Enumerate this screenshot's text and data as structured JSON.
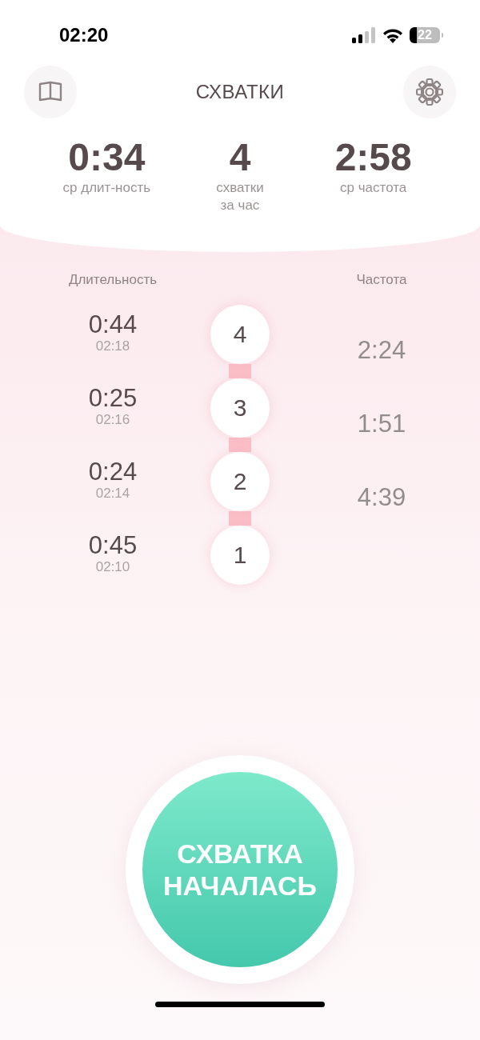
{
  "status_bar": {
    "time": "02:20",
    "battery": "22"
  },
  "header": {
    "title": "СХВАТКИ"
  },
  "stats": [
    {
      "value": "0:34",
      "label": "ср длит-ность"
    },
    {
      "value": "4",
      "label": "схватки\nза час"
    },
    {
      "value": "2:58",
      "label": "ср частота"
    }
  ],
  "list": {
    "duration_heading": "Длительность",
    "frequency_heading": "Частота",
    "contractions": [
      {
        "number": "4",
        "duration": "0:44",
        "start": "02:18"
      },
      {
        "number": "3",
        "duration": "0:25",
        "start": "02:16"
      },
      {
        "number": "2",
        "duration": "0:24",
        "start": "02:14"
      },
      {
        "number": "1",
        "duration": "0:45",
        "start": "02:10"
      }
    ],
    "frequencies": [
      "2:24",
      "1:51",
      "4:39"
    ]
  },
  "start_button": {
    "lines": [
      "СХВАТКА",
      "НАЧАЛАСЬ"
    ]
  }
}
